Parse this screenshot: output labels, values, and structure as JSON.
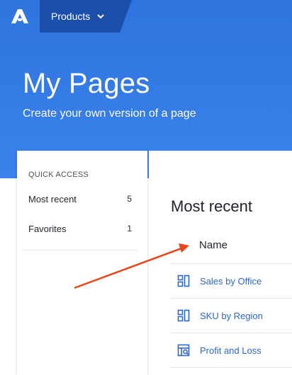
{
  "topbar": {
    "logo_icon": "brand-logo-icon",
    "products_label": "Products",
    "products_chevron_icon": "chevron-down-icon"
  },
  "hero": {
    "title": "My Pages",
    "subtitle": "Create your own version of a page",
    "background_color": "#3079e4"
  },
  "sidebar": {
    "section_label": "QUICK ACCESS",
    "items": [
      {
        "label": "Most recent",
        "count": "5"
      },
      {
        "label": "Favorites",
        "count": "1"
      }
    ]
  },
  "main": {
    "section_title": "Most recent",
    "column_header": "Name",
    "rows": [
      {
        "label": "Sales by Office",
        "icon": "dashboard-layout-icon"
      },
      {
        "label": "SKU by Region",
        "icon": "dashboard-layout-icon"
      },
      {
        "label": "Profit and Loss",
        "icon": "report-search-icon"
      }
    ]
  },
  "annotation": {
    "arrow_color": "#e8451c"
  },
  "colors": {
    "link": "#2b67cf",
    "nav_tab": "#1c4fa9"
  }
}
